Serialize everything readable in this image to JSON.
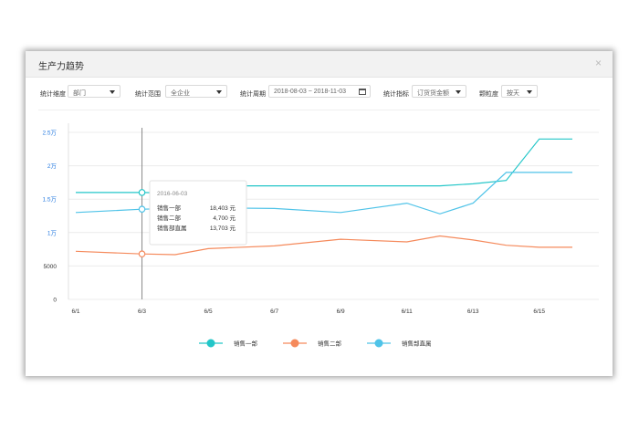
{
  "window": {
    "title": "生产力趋势",
    "close_glyph": "×"
  },
  "filters": {
    "dimension": {
      "label": "统计维度",
      "value": "部门"
    },
    "scope": {
      "label": "统计范围",
      "value": "全企业"
    },
    "period": {
      "label": "统计周期",
      "value": "2018-08-03 ~ 2018-11-03"
    },
    "metric": {
      "label": "统计指标",
      "value": "订货货金额"
    },
    "granularity": {
      "label": "颗粒度",
      "value": "按天"
    }
  },
  "tooltip": {
    "date": "2016-06-03",
    "rows": [
      {
        "name": "销售一部",
        "value": "18,403 元"
      },
      {
        "name": "销售二部",
        "value": "4,700 元"
      },
      {
        "name": "销售部直属",
        "value": "13,703 元"
      }
    ]
  },
  "colors": {
    "series1": "#23c6c8",
    "series2": "#f58a5c",
    "series3": "#4fc3e8",
    "axis_label": "#2a7de1"
  },
  "chart_data": {
    "type": "line",
    "x": [
      "6/1",
      "6/3",
      "6/4",
      "6/5",
      "6/7",
      "6/9",
      "6/11",
      "6/12",
      "6/13",
      "6/14",
      "6/15",
      "6/16"
    ],
    "xticks": [
      "6/1",
      "6/3",
      "6/5",
      "6/7",
      "6/9",
      "6/11",
      "6/13",
      "6/15"
    ],
    "yticks": [
      "0",
      "5000",
      "1万",
      "1.5万",
      "2万",
      "2.5万"
    ],
    "ylim": [
      0,
      25000
    ],
    "grid": true,
    "legend_position": "bottom",
    "highlight_x": "6/3",
    "series": [
      {
        "name": "销售一部",
        "values": [
          16000,
          16000,
          15900,
          17000,
          17000,
          17000,
          17000,
          17000,
          17300,
          17800,
          24000,
          24000
        ]
      },
      {
        "name": "销售二部",
        "values": [
          7200,
          6800,
          6700,
          7600,
          8000,
          9000,
          8600,
          9500,
          8900,
          8100,
          7800,
          7800
        ]
      },
      {
        "name": "销售部直属",
        "values": [
          13000,
          13500,
          13600,
          13700,
          13600,
          13000,
          14400,
          12800,
          14400,
          19000,
          19000,
          19000
        ]
      }
    ]
  }
}
